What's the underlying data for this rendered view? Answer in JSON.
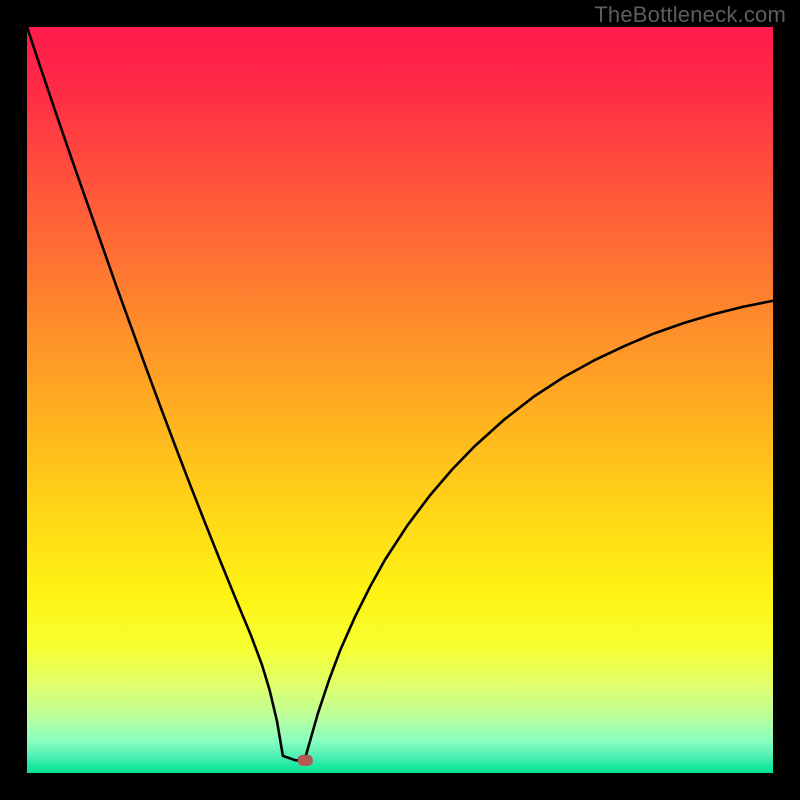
{
  "watermark": "TheBottleneck.com",
  "colors": {
    "frame": "#000000",
    "curve": "#000000",
    "marker_fill": "#b25a52",
    "gradient_stops": [
      {
        "offset": 0.0,
        "color": "#ff1a4b"
      },
      {
        "offset": 0.08,
        "color": "#ff2a46"
      },
      {
        "offset": 0.18,
        "color": "#ff4a3d"
      },
      {
        "offset": 0.3,
        "color": "#ff6e34"
      },
      {
        "offset": 0.42,
        "color": "#ff9329"
      },
      {
        "offset": 0.54,
        "color": "#ffb61e"
      },
      {
        "offset": 0.66,
        "color": "#ffd916"
      },
      {
        "offset": 0.76,
        "color": "#fff314"
      },
      {
        "offset": 0.83,
        "color": "#f7ff30"
      },
      {
        "offset": 0.88,
        "color": "#e1ff69"
      },
      {
        "offset": 0.92,
        "color": "#c0ff97"
      },
      {
        "offset": 0.957,
        "color": "#8affc0"
      },
      {
        "offset": 0.978,
        "color": "#4eefb2"
      },
      {
        "offset": 0.99,
        "color": "#1de9a0"
      },
      {
        "offset": 1.0,
        "color": "#05e290"
      }
    ]
  },
  "chart_data": {
    "type": "line",
    "title": "",
    "xlabel": "",
    "ylabel": "",
    "xlim": [
      0,
      100
    ],
    "ylim": [
      0,
      100
    ],
    "series": [
      {
        "name": "bottleneck-curve-left",
        "x": [
          0,
          2,
          4,
          6,
          8,
          10,
          12,
          14,
          16,
          18,
          20,
          22,
          24,
          26,
          28,
          30,
          31.5,
          32.5,
          33.5,
          34.3
        ],
        "y": [
          100,
          94,
          88.1,
          82.3,
          76.6,
          70.9,
          65.2,
          59.7,
          54.2,
          48.8,
          43.5,
          38.3,
          33.2,
          28.2,
          23.3,
          18.5,
          14.5,
          11.2,
          7.0,
          2.3
        ]
      },
      {
        "name": "bottleneck-curve-flat",
        "x": [
          34.3,
          36.0,
          37.2
        ],
        "y": [
          2.3,
          1.7,
          1.7
        ]
      },
      {
        "name": "bottleneck-curve-right",
        "x": [
          37.2,
          38,
          39,
          40.5,
          42,
          44,
          46,
          48,
          51,
          54,
          57,
          60,
          64,
          68,
          72,
          76,
          80,
          84,
          88,
          92,
          96,
          100
        ],
        "y": [
          1.7,
          4.5,
          8.0,
          12.5,
          16.5,
          21.0,
          25.0,
          28.6,
          33.2,
          37.2,
          40.7,
          43.8,
          47.4,
          50.5,
          53.1,
          55.3,
          57.2,
          58.9,
          60.3,
          61.5,
          62.5,
          63.3
        ]
      }
    ],
    "marker": {
      "x": 37.3,
      "y": 1.7
    },
    "annotations": []
  }
}
